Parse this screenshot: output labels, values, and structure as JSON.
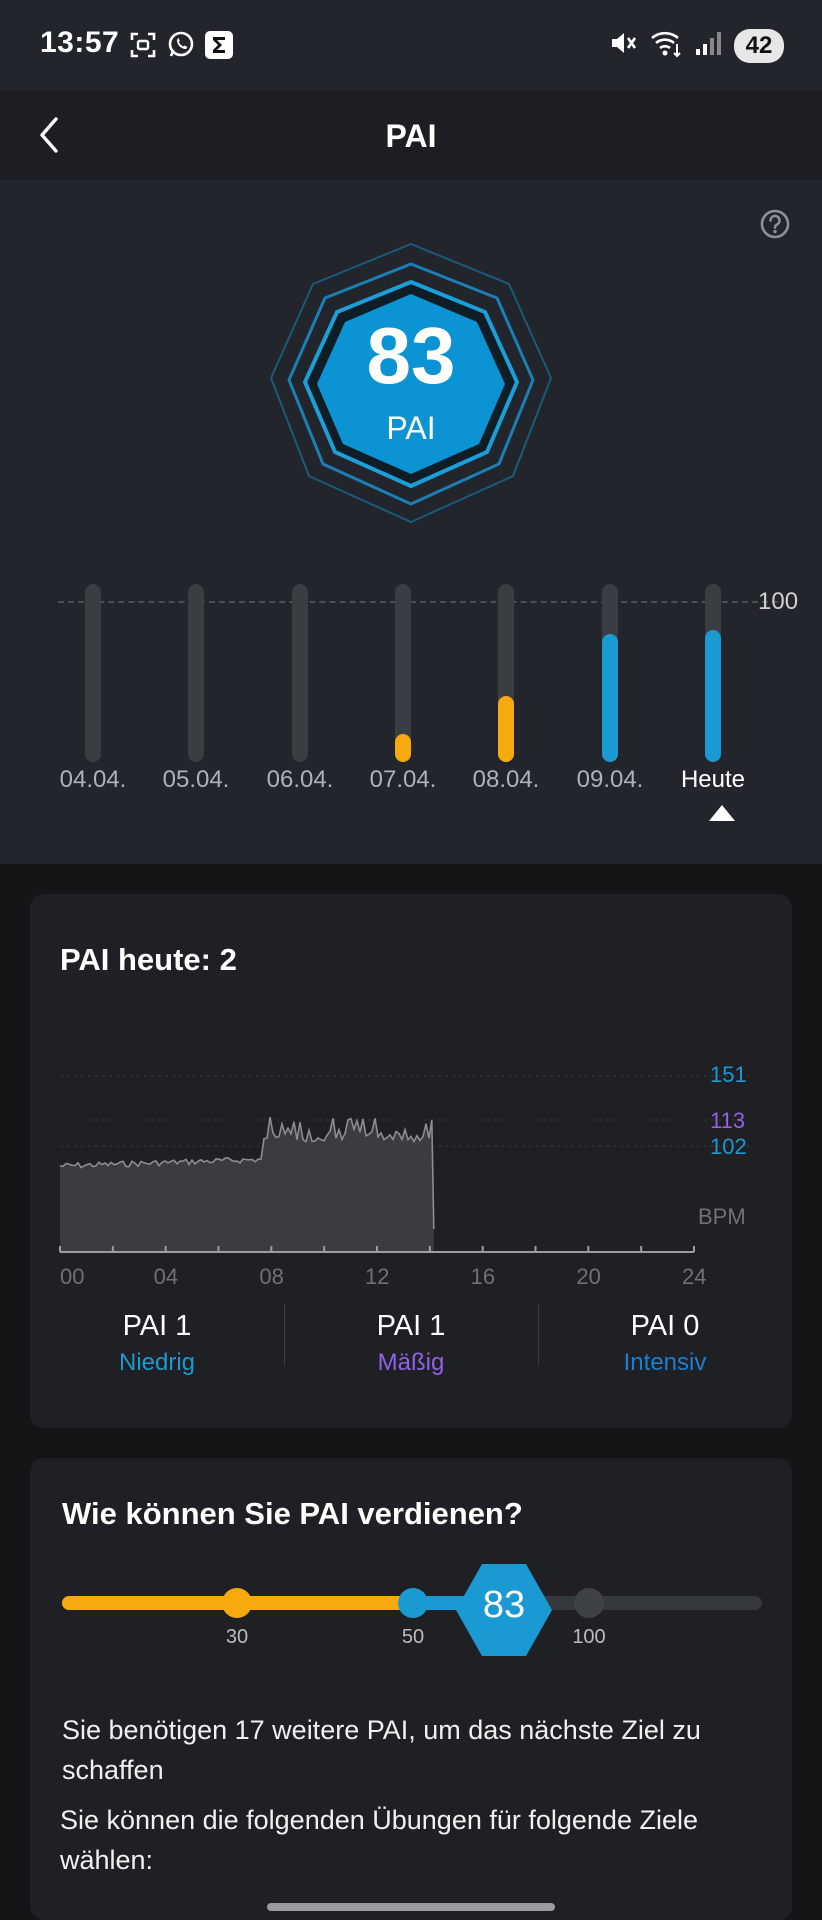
{
  "status_bar": {
    "time": "13:57",
    "battery": "42"
  },
  "header": {
    "title": "PAI"
  },
  "pai": {
    "value": "83",
    "label": "PAI"
  },
  "weekly_chart": {
    "max_label": "100",
    "bars": [
      {
        "label": "04.04.",
        "value": 0,
        "color": ""
      },
      {
        "label": "05.04.",
        "value": 0,
        "color": ""
      },
      {
        "label": "06.04.",
        "value": 0,
        "color": ""
      },
      {
        "label": "07.04.",
        "value": 15,
        "color": "#f7a90e"
      },
      {
        "label": "08.04.",
        "value": 37,
        "color": "#f7a90e"
      },
      {
        "label": "09.04.",
        "value": 72,
        "color": "#1b99d3"
      },
      {
        "label": "Heute",
        "value": 74,
        "color": "#1b99d3"
      }
    ]
  },
  "today_card": {
    "title": "PAI heute: 2",
    "chart": {
      "y_labels": [
        "151",
        "113",
        "102"
      ],
      "unit": "BPM",
      "x_ticks": [
        "00",
        "04",
        "08",
        "12",
        "16",
        "20",
        "24"
      ]
    },
    "zones": [
      {
        "pai": "PAI 1",
        "name": "Niedrig",
        "color": "#1b99d3"
      },
      {
        "pai": "PAI 1",
        "name": "Mäßig",
        "color": "#9161e6"
      },
      {
        "pai": "PAI 0",
        "name": "Intensiv",
        "color": "#1b7fd3"
      }
    ]
  },
  "goal_card": {
    "title": "Wie können Sie PAI verdienen?",
    "milestones": [
      "30",
      "50",
      "100"
    ],
    "current": "83",
    "progress_fraction": 0.83,
    "message": "Sie benötigen 17 weitere PAI, um das nächste Ziel zu schaffen",
    "exercise_hint": "Sie können die folgenden Übungen für folgende Ziele wählen:"
  },
  "colors": {
    "accent": "#1b99d3",
    "warn": "#f7a90e",
    "purple": "#9161e6"
  }
}
